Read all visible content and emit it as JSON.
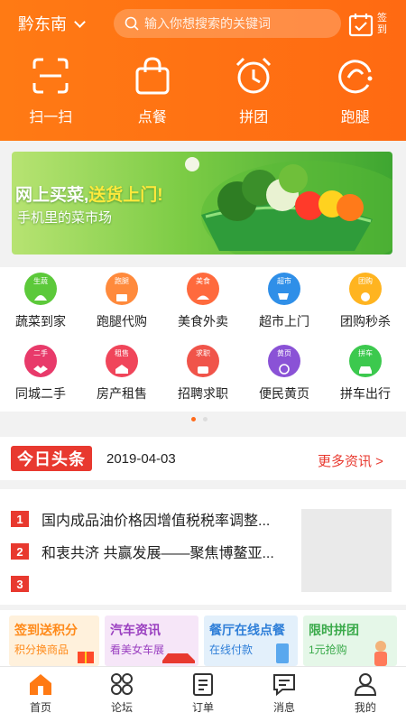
{
  "header": {
    "location": "黔东南",
    "search_placeholder": "输入你想搜索的关键词",
    "signin_label": "签到"
  },
  "quick_actions": [
    {
      "label": "扫一扫",
      "icon": "scan-icon"
    },
    {
      "label": "点餐",
      "icon": "shopping-bag-icon"
    },
    {
      "label": "拼团",
      "icon": "alarm-clock-icon"
    },
    {
      "label": "跑腿",
      "icon": "errand-icon"
    }
  ],
  "banner": {
    "title_white": "网上买菜,",
    "title_yellow": "送货上门!",
    "subtitle": "手机里的菜市场"
  },
  "categories": [
    {
      "label": "蔬菜到家",
      "tag": "生蔬",
      "color": "#5cc93a"
    },
    {
      "label": "跑腿代购",
      "tag": "跑腿",
      "color": "#ff8a3c"
    },
    {
      "label": "美食外卖",
      "tag": "美食",
      "color": "#ff6a3d"
    },
    {
      "label": "超市上门",
      "tag": "超市",
      "color": "#2f8fe8"
    },
    {
      "label": "团购秒杀",
      "tag": "团购",
      "color": "#ffb420"
    },
    {
      "label": "同城二手",
      "tag": "二手",
      "color": "#e83a6a"
    },
    {
      "label": "房产租售",
      "tag": "租售",
      "color": "#f0455a"
    },
    {
      "label": "招聘求职",
      "tag": "求职",
      "color": "#f0544a"
    },
    {
      "label": "便民黄页",
      "tag": "黄页",
      "color": "#8a52d6"
    },
    {
      "label": "拼车出行",
      "tag": "拼车",
      "color": "#3cc94e"
    }
  ],
  "carousel": {
    "active_page": 1,
    "pages": 2
  },
  "headline": {
    "logo": "今日头条",
    "date": "2019-04-03",
    "more": "更多资讯 >",
    "items": [
      {
        "num": "1",
        "text": "国内成品油价格因增值税税率调整..."
      },
      {
        "num": "2",
        "text": "和衷共济 共赢发展——聚焦博鳌亚..."
      },
      {
        "num": "3",
        "text": ""
      }
    ]
  },
  "promos": [
    {
      "title": "签到送积分",
      "subtitle": "积分换商品",
      "bg": "#fff1dc",
      "fg": "#ff8a1a"
    },
    {
      "title": "汽车资讯",
      "subtitle": "看美女车展",
      "bg": "#f6e6f8",
      "fg": "#9a3fc0"
    },
    {
      "title": "餐厅在线点餐",
      "subtitle": "在线付款",
      "bg": "#e3f0fb",
      "fg": "#2f7fd8"
    },
    {
      "title": "限时拼团",
      "subtitle": "1元抢购",
      "bg": "#e5f7e8",
      "fg": "#3aaa4a"
    }
  ],
  "tabbar": [
    {
      "label": "首页",
      "icon": "home-icon",
      "active": true
    },
    {
      "label": "论坛",
      "icon": "forum-icon",
      "active": false
    },
    {
      "label": "订单",
      "icon": "order-icon",
      "active": false
    },
    {
      "label": "消息",
      "icon": "message-icon",
      "active": false
    },
    {
      "label": "我的",
      "icon": "profile-icon",
      "active": false
    }
  ],
  "colors": {
    "accent": "#ff6a12",
    "news_red": "#e8392f"
  }
}
